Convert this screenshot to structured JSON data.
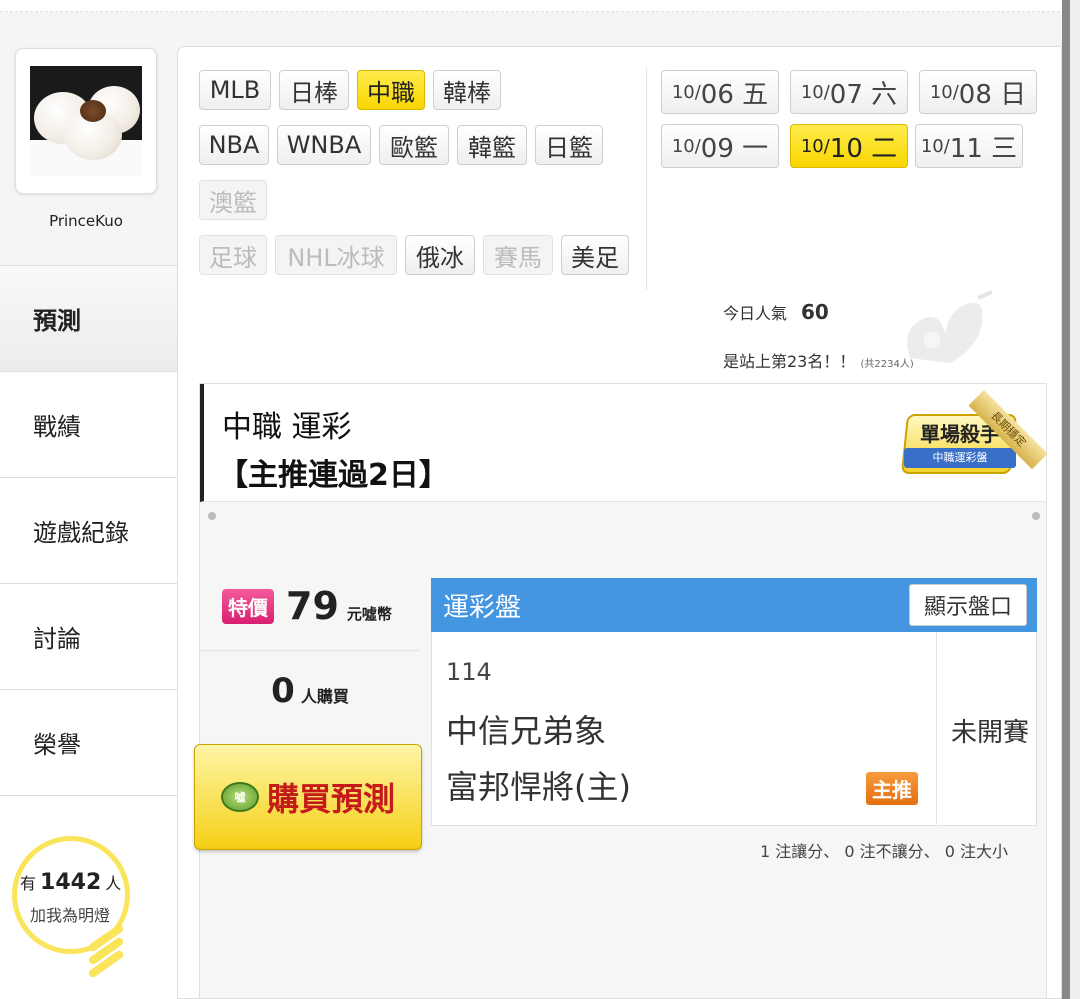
{
  "user": {
    "name": "PrinceKuo"
  },
  "nav": [
    "預測",
    "戰績",
    "遊戲紀錄",
    "討論",
    "榮譽"
  ],
  "fans": {
    "prefix": "有",
    "count": "1442",
    "suffix": "人",
    "label": "加我為明燈"
  },
  "sports": {
    "row1": [
      "MLB",
      "日棒",
      "中職",
      "韓棒"
    ],
    "row2": [
      "NBA",
      "WNBA",
      "歐籃",
      "韓籃",
      "日籃"
    ],
    "row3": [
      "澳籃"
    ],
    "row4": [
      "足球",
      "NHL冰球",
      "俄冰",
      "賽馬",
      "美足"
    ],
    "selected": "中職"
  },
  "dates": [
    {
      "md": "10/",
      "d": "06 五"
    },
    {
      "md": "10/",
      "d": "07 六"
    },
    {
      "md": "10/",
      "d": "08 日"
    },
    {
      "md": "10/",
      "d": "09 一"
    },
    {
      "md": "10/",
      "d": "10 二"
    },
    {
      "md": "10/",
      "d": "11 三"
    }
  ],
  "popularity": {
    "label": "今日人氣",
    "value": "60",
    "rank": "是站上第23名！！",
    "total": "(共2234人)"
  },
  "card": {
    "title": "中職 運彩",
    "subtitle": "【主推連過2日】",
    "badge": "單場殺手",
    "badge_ribbon": "中職運彩盤",
    "corner": "長期穩定"
  },
  "price": {
    "tag": "特價",
    "value": "79",
    "unit": "元噓幣"
  },
  "buyers": {
    "count": "0",
    "label": "人購買"
  },
  "buy_button": "購買預測",
  "coin_label": "噓",
  "odds": {
    "header": "運彩盤",
    "show_button": "顯示盤口",
    "game_no": "114",
    "team_away": "中信兄弟象",
    "team_home": "富邦悍將(主)",
    "pick_tag": "主推",
    "status": "未開賽"
  },
  "summary": "1 注讓分、 0 注不讓分、 0 注大小",
  "colors": {
    "accent": "#4596e0",
    "selected": "#f8d600",
    "tejia": "#d81f6f",
    "zhutui": "#e46f10"
  }
}
